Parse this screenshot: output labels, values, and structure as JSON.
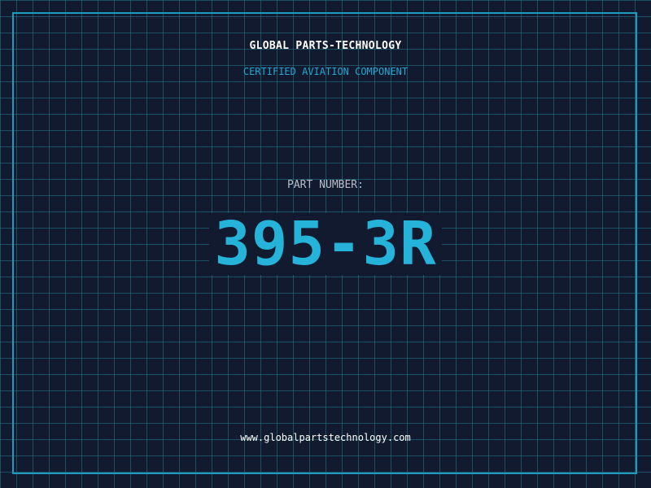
{
  "brand": {
    "name": "GLOBAL PARTS-TECHNOLOGY",
    "tagline": "CERTIFIED AVIATION COMPONENT"
  },
  "part": {
    "label": "PART NUMBER:",
    "number": "395-3R"
  },
  "footer": {
    "website": "www.globalpartstechnology.com"
  },
  "colors": {
    "background": "#111a2e",
    "grid": "#28788c",
    "accent": "#25b3d9",
    "frame": "#1c9bbf"
  }
}
